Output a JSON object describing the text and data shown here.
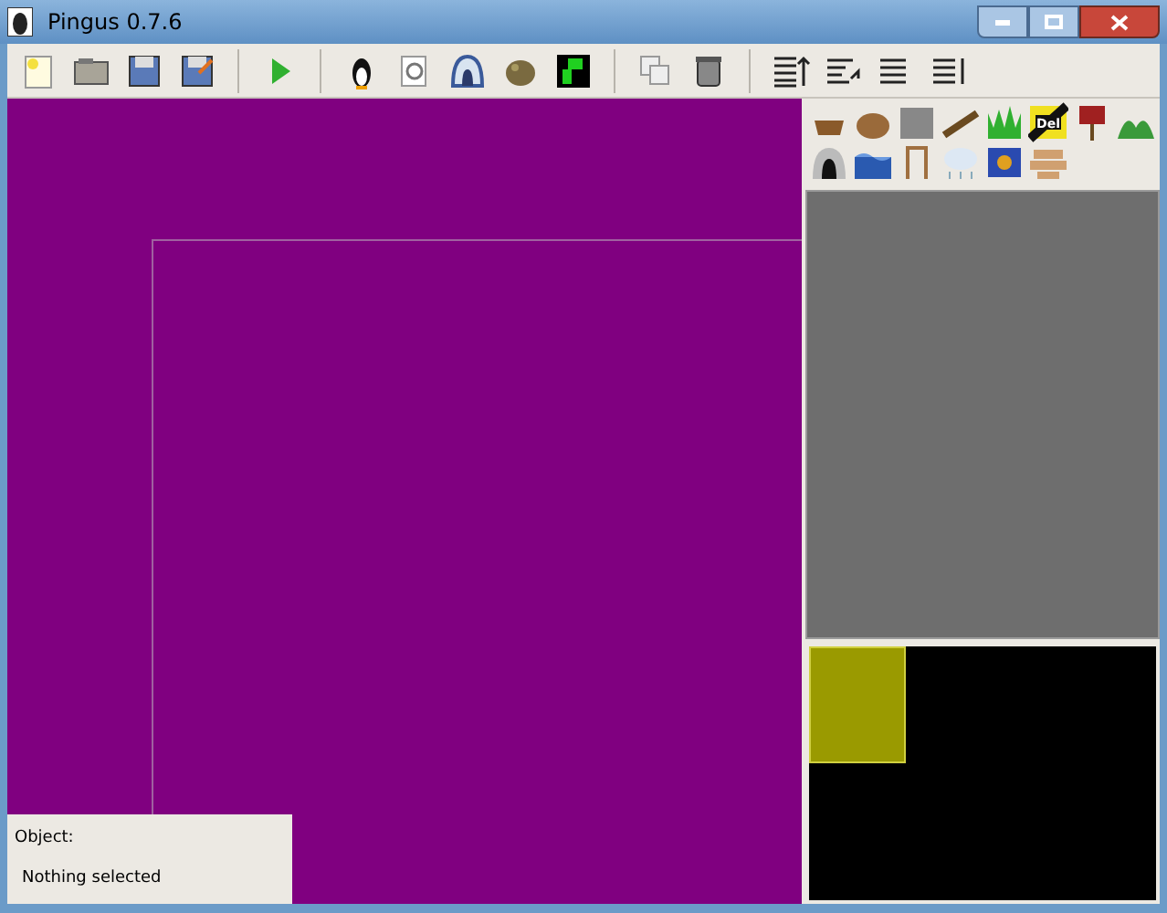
{
  "window": {
    "title": "Pingus 0.7.6"
  },
  "object_palette": {
    "delete_icon_label": "Del"
  },
  "object_panel": {
    "label": "Object:",
    "value": "Nothing selected"
  }
}
